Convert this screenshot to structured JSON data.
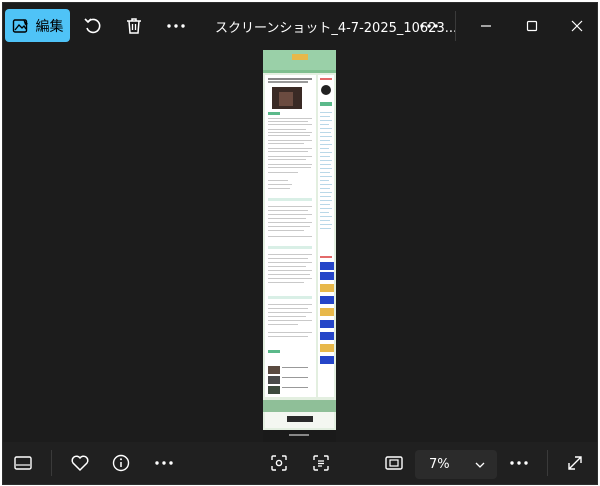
{
  "toolbar": {
    "edit_label": "編集",
    "file_title": "スクリーンショット_4-7-2025_10623..."
  },
  "statusbar": {
    "zoom_value": "7%"
  },
  "colors": {
    "window_bg": "#1c1c1c",
    "bottom_bar_bg": "#202020",
    "edit_button_bg": "#4fc3f7",
    "zoom_box_bg": "#2b2b2b"
  }
}
